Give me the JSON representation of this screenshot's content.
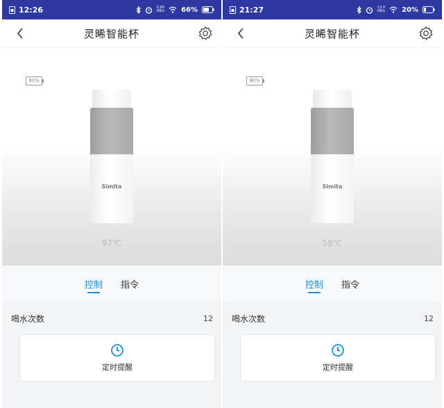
{
  "panels": [
    {
      "status": {
        "time": "12:26",
        "net_speed": [
          "0.60",
          "KB/s"
        ],
        "battery": "66%"
      },
      "header": {
        "title": "灵晞智能杯"
      },
      "device": {
        "battery": "90%",
        "brand": "Simita",
        "temperature": "97℃"
      },
      "tabs": [
        {
          "label": "控制",
          "active": true
        },
        {
          "label": "指令",
          "active": false
        }
      ],
      "stat": {
        "label": "喝水次数",
        "value": "12"
      },
      "card": {
        "label": "定时提醒"
      }
    },
    {
      "status": {
        "time": "21:27",
        "net_speed": [
          "13.0",
          "KB/s"
        ],
        "battery": "20%"
      },
      "header": {
        "title": "灵晞智能杯"
      },
      "device": {
        "battery": "90%",
        "brand": "Simita",
        "temperature": "58℃"
      },
      "tabs": [
        {
          "label": "控制",
          "active": true
        },
        {
          "label": "指令",
          "active": false
        }
      ],
      "stat": {
        "label": "喝水次数",
        "value": "12"
      },
      "card": {
        "label": "定时提醒"
      }
    }
  ],
  "colors": {
    "statusbar": "#2e38a1",
    "accent": "#1a8fd9"
  }
}
